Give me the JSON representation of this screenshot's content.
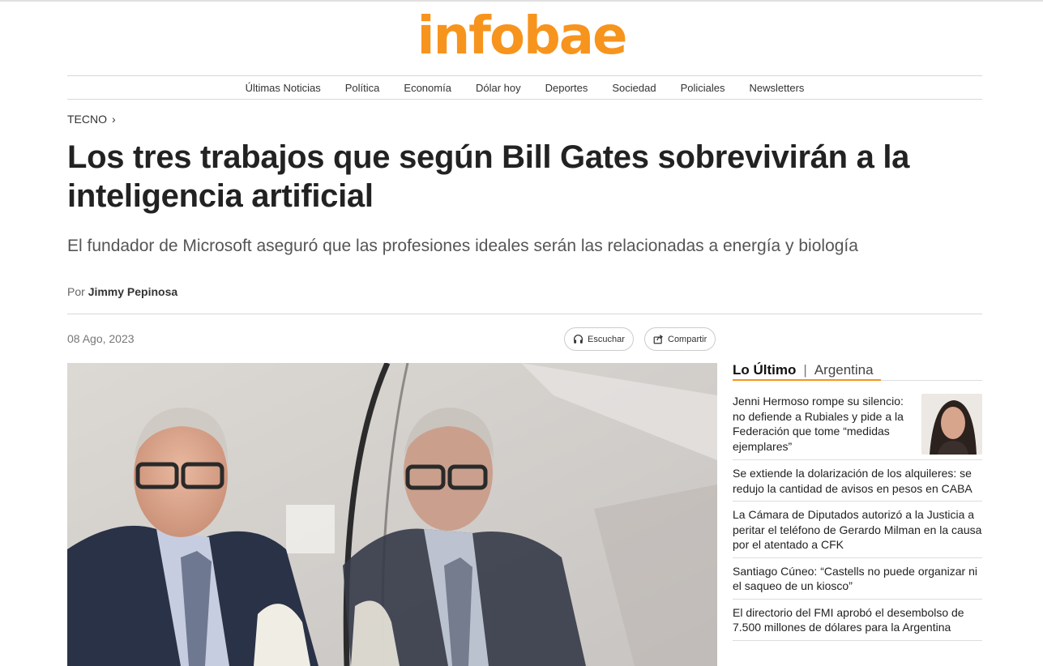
{
  "site": {
    "logo": "infobae"
  },
  "nav": {
    "items": [
      "Últimas Noticias",
      "Política",
      "Economía",
      "Dólar hoy",
      "Deportes",
      "Sociedad",
      "Policiales",
      "Newsletters"
    ]
  },
  "breadcrumb": {
    "section": "TECNO",
    "chevron": "›"
  },
  "article": {
    "headline": "Los tres trabajos que según Bill Gates sobrevivirán a la inteligencia artificial",
    "subtitle": "El fundador de Microsoft aseguró que las profesiones ideales serán las relacionadas a energía y biología",
    "byline_prefix": "Por",
    "author": "Jimmy Pepinosa",
    "date": "08 Ago, 2023"
  },
  "actions": {
    "listen_label": "Escuchar",
    "listen_icon": "headphones-icon",
    "share_label": "Compartir",
    "share_icon": "share-icon"
  },
  "sidebar": {
    "title": "Lo Último",
    "separator": "|",
    "region": "Argentina",
    "accent_color": "#f7941d",
    "items": [
      "Jenni Hermoso rompe su silencio: no defiende a Rubiales y pide a la Federación que tome “medidas ejemplares”",
      "Se extiende la dolarización de los alquileres: se redujo la cantidad de avisos en pesos en CABA",
      "La Cámara de Diputados autorizó a la Justicia a peritar el teléfono de Gerardo Milman en la causa por el atentado a CFK",
      "Santiago Cúneo: “Castells no puede organizar ni el saqueo de un kiosco”",
      "El directorio del FMI aprobó el desembolso de 7.500 millones de dólares para la Argentina"
    ]
  },
  "colors": {
    "brand": "#f7941d",
    "text": "#222222",
    "muted": "#777777"
  }
}
